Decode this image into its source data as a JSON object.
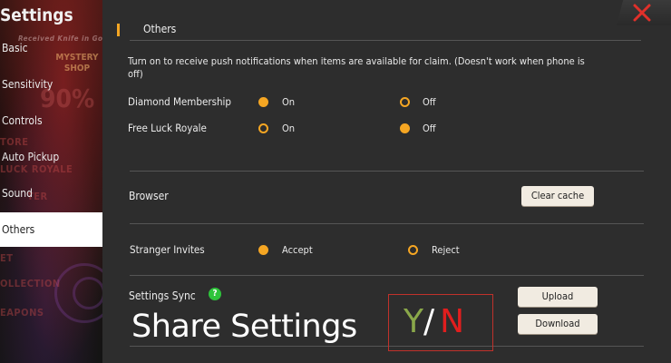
{
  "sidebar": {
    "title": "Settings",
    "items": [
      {
        "label": "Basic"
      },
      {
        "label": "Sensitivity"
      },
      {
        "label": "Controls"
      },
      {
        "label": "Auto Pickup"
      },
      {
        "label": "Sound"
      },
      {
        "label": "Others"
      }
    ]
  },
  "backdrop": {
    "banner": "Received Knife in Gold",
    "shop": "MYSTERY SHOP",
    "percent": "90%",
    "labels": [
      "TORE",
      "LUCK ROYALE",
      "TER",
      "ET",
      "OLLECTION",
      "EAPONS"
    ]
  },
  "section": {
    "title": "Others"
  },
  "notifications": {
    "note": "Turn on to receive push notifications when items are available for claim. (Doesn't work when phone is off)",
    "rows": [
      {
        "label": "Diamond Membership",
        "on": "On",
        "off": "Off",
        "selected": "on"
      },
      {
        "label": "Free Luck Royale",
        "on": "On",
        "off": "Off",
        "selected": "off"
      }
    ]
  },
  "browser": {
    "label": "Browser",
    "button": "Clear cache"
  },
  "stranger": {
    "label": "Stranger Invites",
    "accept": "Accept",
    "reject": "Reject",
    "selected": "accept"
  },
  "sync": {
    "label": "Settings Sync",
    "help": "?",
    "upload": "Upload",
    "download": "Download"
  },
  "overlay": {
    "caption": "Share Settings",
    "yes": "Y",
    "slash": "/",
    "no": "N"
  },
  "colors": {
    "accent": "#f5a623",
    "help": "#2ec43b",
    "close": "#e0302a"
  }
}
